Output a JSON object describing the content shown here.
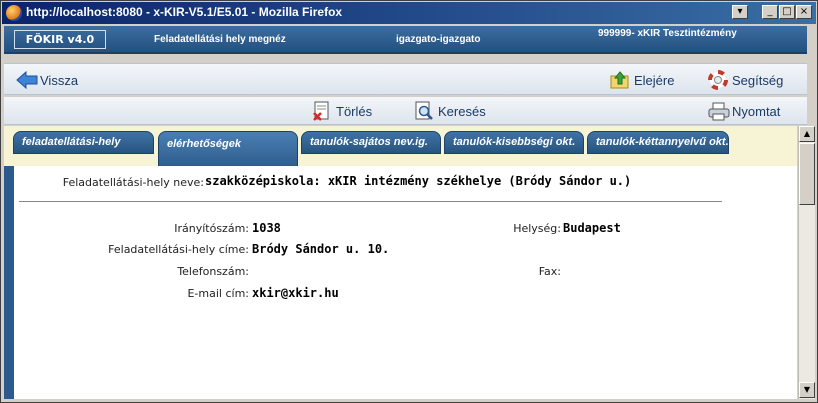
{
  "window": {
    "title": "http://localhost:8080 - x-KIR-V5.1/E5.01 - Mozilla Firefox",
    "buttons": [
      "▾",
      "_",
      "□",
      "×"
    ]
  },
  "header": {
    "logo": "FÖKIR v4.0",
    "page_title": "Feladatellátási hely megnéz",
    "user": "igazgato-igazgato",
    "institution": "999999- xKIR Tesztintézmény"
  },
  "toolbar": {
    "back": "Vissza",
    "home": "Elejére",
    "help": "Segítség",
    "delete": "Törlés",
    "search": "Keresés",
    "print": "Nyomtat"
  },
  "tabs": [
    {
      "label": "feladatellátási-hely"
    },
    {
      "label": "elérhetőségek"
    },
    {
      "label": "tanulók-sajátos nev.ig."
    },
    {
      "label": "tanulók-kisebbségi okt."
    },
    {
      "label": "tanulók-kéttannyelvű okt."
    }
  ],
  "form": {
    "site_name_label": "Feladatellátási-hely neve:",
    "site_name_value": "szakközépiskola: xKIR intézmény székhelye (Bródy Sándor u.)",
    "zip_label": "Irányítószám:",
    "zip_value": "1038",
    "city_label": "Helység:",
    "city_value": "Budapest",
    "address_label": "Feladatellátási-hely címe:",
    "address_value": "Bródy Sándor u. 10.",
    "phone_label": "Telefonszám:",
    "phone_value": "",
    "fax_label": "Fax:",
    "fax_value": "",
    "email_label": "E-mail cím:",
    "email_value": "xkir@xkir.hu"
  }
}
